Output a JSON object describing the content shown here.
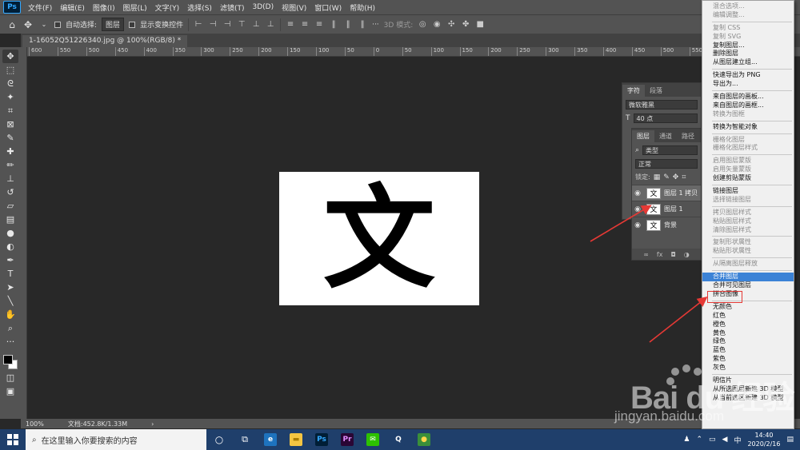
{
  "menubar": {
    "logo": "Ps",
    "items": [
      "文件(F)",
      "编辑(E)",
      "图像(I)",
      "图层(L)",
      "文字(Y)",
      "选择(S)",
      "滤镜(T)",
      "3D(D)",
      "视图(V)",
      "窗口(W)",
      "帮助(H)"
    ]
  },
  "options": {
    "auto_select_label": "自动选择:",
    "auto_select_value": "图层",
    "show_transform_label": "显示变换控件",
    "mode_3d_label": "3D 模式:"
  },
  "document": {
    "tab_title": "1-16052Q51226340.jpg @ 100%(RGB/8) *",
    "canvas_char": "文"
  },
  "ruler": {
    "ticks": [
      "600",
      "550",
      "500",
      "450",
      "400",
      "350",
      "300",
      "250",
      "200",
      "150",
      "100",
      "50",
      "0",
      "50",
      "100",
      "150",
      "200",
      "250",
      "300",
      "350",
      "400",
      "450",
      "500",
      "550",
      "600",
      "650",
      "700",
      "750",
      "800",
      "850"
    ]
  },
  "status": {
    "zoom": "100%",
    "doc_size": "文档:452.8K/1.33M"
  },
  "char_panel": {
    "tabs": [
      "字符",
      "段落"
    ],
    "font": "微软雅黑",
    "size": "40 点"
  },
  "layers_panel": {
    "tabs": [
      "图层",
      "通道",
      "路径"
    ],
    "kind_filter": "类型",
    "blend_mode": "正常",
    "lock_label": "锁定:",
    "layers": [
      {
        "thumb": "文",
        "name": "图层 1 拷贝",
        "selected": true
      },
      {
        "thumb": "文",
        "name": "图层 1",
        "selected": false
      },
      {
        "thumb": "文",
        "name": "背景",
        "selected": false
      }
    ],
    "footer_icons": [
      "∞",
      "fx"
    ]
  },
  "context_menu": {
    "items": [
      {
        "label": "混合选项...",
        "disabled": true
      },
      {
        "label": "编辑调整...",
        "disabled": true
      },
      {
        "sep": true
      },
      {
        "label": "复制 CSS",
        "disabled": true
      },
      {
        "label": "复制 SVG",
        "disabled": true
      },
      {
        "label": "复制图层...",
        "disabled": false
      },
      {
        "label": "删除图层",
        "disabled": false
      },
      {
        "label": "从图层建立组...",
        "disabled": false
      },
      {
        "sep": true
      },
      {
        "label": "快速导出为 PNG",
        "disabled": false
      },
      {
        "label": "导出为...",
        "disabled": false
      },
      {
        "sep": true
      },
      {
        "label": "来自图层的画板...",
        "disabled": false
      },
      {
        "label": "来自图层的画框...",
        "disabled": false
      },
      {
        "label": "转换为图框",
        "disabled": true
      },
      {
        "sep": true
      },
      {
        "label": "转换为智能对象",
        "disabled": false
      },
      {
        "sep": true
      },
      {
        "label": "栅格化图层",
        "disabled": true
      },
      {
        "label": "栅格化图层样式",
        "disabled": true
      },
      {
        "sep": true
      },
      {
        "label": "启用图层蒙版",
        "disabled": true
      },
      {
        "label": "启用矢量蒙版",
        "disabled": true
      },
      {
        "label": "创建剪贴蒙版",
        "disabled": false
      },
      {
        "sep": true
      },
      {
        "label": "链接图层",
        "disabled": false
      },
      {
        "label": "选择链接图层",
        "disabled": true
      },
      {
        "sep": true
      },
      {
        "label": "拷贝图层样式",
        "disabled": true
      },
      {
        "label": "粘贴图层样式",
        "disabled": true
      },
      {
        "label": "清除图层样式",
        "disabled": true
      },
      {
        "sep": true
      },
      {
        "label": "复制形状属性",
        "disabled": true
      },
      {
        "label": "粘贴形状属性",
        "disabled": true
      },
      {
        "sep": true
      },
      {
        "label": "从隔离图层释放",
        "disabled": true
      },
      {
        "sep": true
      },
      {
        "label": "合并图层",
        "disabled": false,
        "highlight": true
      },
      {
        "label": "合并可见图层",
        "disabled": false
      },
      {
        "label": "拼合图像",
        "disabled": false
      },
      {
        "sep": true
      },
      {
        "label": "无颜色",
        "disabled": false
      },
      {
        "label": "红色",
        "disabled": false
      },
      {
        "label": "橙色",
        "disabled": false
      },
      {
        "label": "黄色",
        "disabled": false
      },
      {
        "label": "绿色",
        "disabled": false
      },
      {
        "label": "蓝色",
        "disabled": false
      },
      {
        "label": "紫色",
        "disabled": false
      },
      {
        "label": "灰色",
        "disabled": false
      },
      {
        "sep": true
      },
      {
        "label": "明信片",
        "disabled": false
      },
      {
        "label": "从所选图层新建 3D 模型",
        "disabled": false
      },
      {
        "label": "从当前选区新建 3D 模型",
        "disabled": false
      }
    ]
  },
  "watermark": {
    "text": "Bai du 经验",
    "url": "jingyan.baidu.com"
  },
  "taskbar": {
    "search_placeholder": "在这里输入你要搜索的内容",
    "apps": [
      {
        "name": "edge-icon",
        "glyph": "e",
        "bg": "#1e73be",
        "fg": "#fff"
      },
      {
        "name": "explorer-icon",
        "glyph": "▬",
        "bg": "#f4c542",
        "fg": "#a87b00"
      },
      {
        "name": "photoshop-icon",
        "glyph": "Ps",
        "bg": "#001e36",
        "fg": "#31a8ff"
      },
      {
        "name": "premiere-icon",
        "glyph": "Pr",
        "bg": "#2a0634",
        "fg": "#e28cff"
      },
      {
        "name": "wechat-icon",
        "glyph": "✉",
        "bg": "#2dc100",
        "fg": "#fff"
      },
      {
        "name": "qq-icon",
        "glyph": "Q",
        "bg": "#1f3f6b",
        "fg": "#fff"
      },
      {
        "name": "browser-icon",
        "glyph": "●",
        "bg": "#3a8f3a",
        "fg": "#ffd54a"
      }
    ],
    "ime": "中",
    "time": "14:40",
    "date": "2020/2/16"
  },
  "colors": {
    "highlight": "#3b82d6",
    "annotation": "#e53935"
  }
}
